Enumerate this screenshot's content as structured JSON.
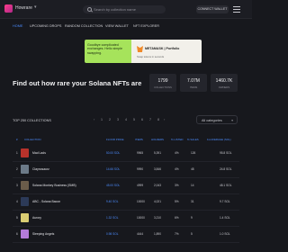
{
  "header": {
    "brand": "Howrare",
    "search_placeholder": "Search by collection name",
    "connect_wallet": "CONNECT WALLET"
  },
  "nav": {
    "items": [
      "HOME",
      "UPCOMING DROPS",
      "RANDOM COLLECTION",
      "VIEW WALLET",
      "NFT EXPLORER"
    ]
  },
  "banner": {
    "text": "Goodbye complicated exchanges. Hello simple swapping.",
    "brand": "METAMASK | Portfolio",
    "caption": "Swap tokens in seconds"
  },
  "hero": {
    "headline": "Find out how rare your Solana NFTs are",
    "stats": [
      {
        "value": "1799",
        "label": "COLLECTIONS"
      },
      {
        "value": "7.07M",
        "label": "ITEMS"
      },
      {
        "value": "1460.7K",
        "label": "OWNERS"
      }
    ]
  },
  "collections": {
    "title": "TOP 250 COLLECTIONS",
    "pages": [
      "1",
      "2",
      "3",
      "4",
      "5",
      "6",
      "7",
      "8"
    ],
    "category_select": "All categories",
    "columns": [
      "#",
      "COLLECTION",
      "FLOOR PRICE",
      "ITEMS",
      "HOLDERS",
      "% LISTED",
      "% SALES",
      "1H AVERAGE (SOL)"
    ],
    "rows": [
      {
        "rank": "1",
        "name": "Mad Lads",
        "floor": "50.00 SOL",
        "items": "9965",
        "holders": "5,391",
        "listed": "4%",
        "sales": "126",
        "avg": "95.8 SOL",
        "thumb_color": "#b8322b"
      },
      {
        "rank": "2",
        "name": "Claynosaurz",
        "floor": "14.66 SOL",
        "items": "9990",
        "holders": "3,846",
        "listed": "4%",
        "sales": "48",
        "avg": "24.8 SOL",
        "thumb_color": "#6c7a88"
      },
      {
        "rank": "3",
        "name": "Solana Monkey Business (SMB)",
        "floor": "45.00 SOL",
        "items": "4999",
        "holders": "2,043",
        "listed": "3%",
        "sales": "14",
        "avg": "48.1 SOL",
        "thumb_color": "#6a5c4a"
      },
      {
        "rank": "4",
        "name": "ABC - Solana Bacon",
        "floor": "9.40 SOL",
        "items": "10000",
        "holders": "4,021",
        "listed": "5%",
        "sales": "31",
        "avg": "9.7 SOL",
        "thumb_color": "#2c3a58"
      },
      {
        "rank": "5",
        "name": "Aurory",
        "floor": "1.32 SOL",
        "items": "10000",
        "holders": "3,210",
        "listed": "6%",
        "sales": "9",
        "avg": "1.4 SOL",
        "thumb_color": "#d9cc73"
      },
      {
        "rank": "6",
        "name": "Sleeping Angels",
        "floor": "0.98 SOL",
        "items": "4444",
        "holders": "1,890",
        "listed": "7%",
        "sales": "5",
        "avg": "1.0 SOL",
        "thumb_color": "#b37bd9"
      }
    ]
  }
}
